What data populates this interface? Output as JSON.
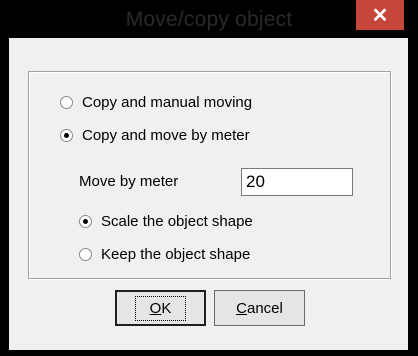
{
  "window": {
    "title": "Move/copy object",
    "close_glyph": "✕"
  },
  "options": {
    "copy_manual": "Copy and manual moving",
    "copy_meter": "Copy and move by meter",
    "selected": "copy_meter"
  },
  "meter": {
    "label": "Move by meter",
    "value": "20"
  },
  "shape": {
    "scale": "Scale the object shape",
    "keep": "Keep the object shape",
    "selected": "scale"
  },
  "buttons": {
    "ok_mnemonic": "O",
    "ok_rest": "K",
    "cancel_mnemonic": "C",
    "cancel_rest": "ancel"
  },
  "colors": {
    "frame": "#000000",
    "close_button": "#c7463b",
    "client": "#f0f0f0"
  }
}
